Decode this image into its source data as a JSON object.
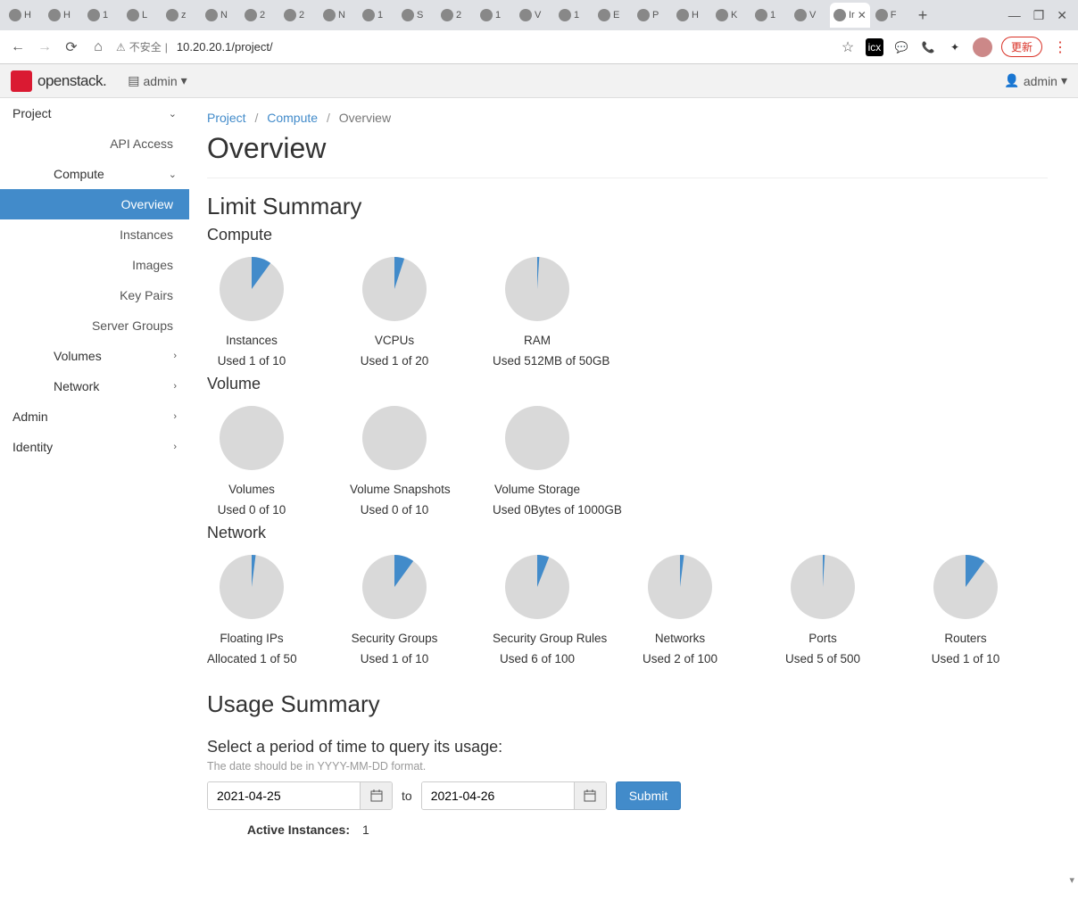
{
  "browser": {
    "tabs": [
      "H",
      "H",
      "1",
      "L",
      "z",
      "N",
      "2",
      "2",
      "N",
      "1",
      "S",
      "2",
      "1",
      "V",
      "1",
      "E",
      "P",
      "H",
      "K",
      "1",
      "V",
      "Ir",
      "F"
    ],
    "active_index": 21,
    "security_label": "不安全",
    "url": "10.20.20.1/project/",
    "update_label": "更新"
  },
  "topbar": {
    "brand": "openstack.",
    "domain_label": "admin",
    "user_label": "admin"
  },
  "sidebar": {
    "project": "Project",
    "api_access": "API Access",
    "compute": "Compute",
    "compute_items": {
      "overview": "Overview",
      "instances": "Instances",
      "images": "Images",
      "key_pairs": "Key Pairs",
      "server_groups": "Server Groups"
    },
    "volumes": "Volumes",
    "network": "Network",
    "admin": "Admin",
    "identity": "Identity"
  },
  "breadcrumb": {
    "project": "Project",
    "compute": "Compute",
    "current": "Overview"
  },
  "page_title": "Overview",
  "sections": {
    "limit": "Limit Summary",
    "compute": "Compute",
    "volume": "Volume",
    "network": "Network",
    "usage": "Usage Summary",
    "period_heading": "Select a period of time to query its usage:",
    "period_hint": "The date should be in YYYY-MM-DD format."
  },
  "dates": {
    "from": "2021-04-25",
    "to_label": "to",
    "to": "2021-04-26",
    "submit": "Submit"
  },
  "stats": {
    "active_instances_label": "Active Instances:",
    "active_instances_value": "1"
  },
  "chart_data": [
    {
      "group": "compute",
      "name": "Instances",
      "label": "Used 1 of 10",
      "used": 1,
      "total": 10
    },
    {
      "group": "compute",
      "name": "VCPUs",
      "label": "Used 1 of 20",
      "used": 1,
      "total": 20
    },
    {
      "group": "compute",
      "name": "RAM",
      "label": "Used 512MB of 50GB",
      "used": 0.512,
      "total": 50
    },
    {
      "group": "volume",
      "name": "Volumes",
      "label": "Used 0 of 10",
      "used": 0,
      "total": 10
    },
    {
      "group": "volume",
      "name": "Volume Snapshots",
      "label": "Used 0 of 10",
      "used": 0,
      "total": 10
    },
    {
      "group": "volume",
      "name": "Volume Storage",
      "label": "Used 0Bytes of 1000GB",
      "used": 0,
      "total": 1000
    },
    {
      "group": "network",
      "name": "Floating IPs",
      "label": "Allocated 1 of 50",
      "used": 1,
      "total": 50
    },
    {
      "group": "network",
      "name": "Security Groups",
      "label": "Used 1 of 10",
      "used": 1,
      "total": 10
    },
    {
      "group": "network",
      "name": "Security Group Rules",
      "label": "Used 6 of 100",
      "used": 6,
      "total": 100
    },
    {
      "group": "network",
      "name": "Networks",
      "label": "Used 2 of 100",
      "used": 2,
      "total": 100
    },
    {
      "group": "network",
      "name": "Ports",
      "label": "Used 5 of 500",
      "used": 5,
      "total": 500
    },
    {
      "group": "network",
      "name": "Routers",
      "label": "Used 1 of 10",
      "used": 1,
      "total": 10
    }
  ]
}
